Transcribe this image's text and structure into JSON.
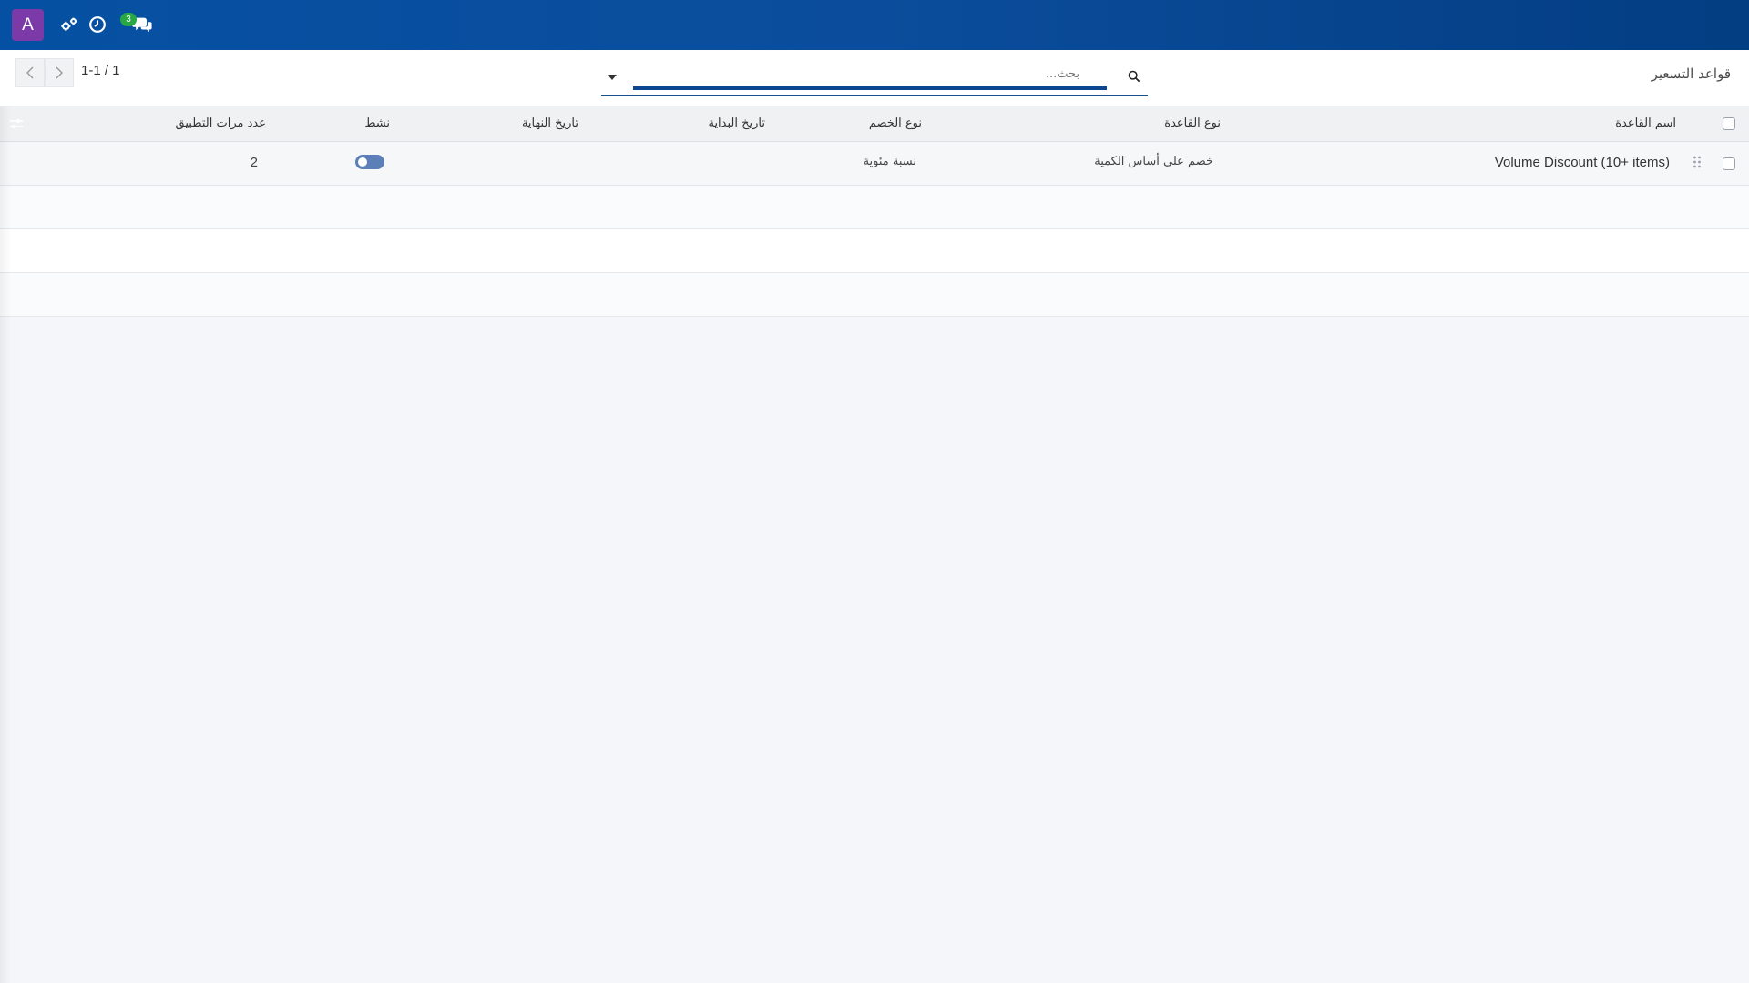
{
  "navbar": {
    "avatar_letter": "A",
    "icons": [
      "settings-cogs-icon",
      "clock-icon",
      "chat-icon"
    ],
    "chat_badge": "3",
    "colors": {
      "bar_start": "#0650a3",
      "bar_end": "#033d82",
      "avatar": "#7c3aa8",
      "badge": "#28a745"
    }
  },
  "control": {
    "breadcrumb": "قواعد التسعير",
    "search": {
      "placeholder": "بحث...",
      "value": ""
    },
    "pager": {
      "value": "1-1 / 1"
    }
  },
  "table": {
    "columns": {
      "name": "اسم القاعدة",
      "rule_type": "نوع القاعدة",
      "discount_type": "نوع الخصم",
      "start_date": "تاريخ البداية",
      "end_date": "تاريخ النهاية",
      "active": "نشط",
      "usage_count": "عدد مرات التطبيق"
    },
    "rows": [
      {
        "name": "Volume Discount (10+ items)",
        "rule_type": "خصم على أساس الكمية",
        "discount_type": "نسبة مئوية",
        "start_date": "",
        "end_date": "",
        "active": true,
        "usage_count": "2"
      }
    ]
  }
}
